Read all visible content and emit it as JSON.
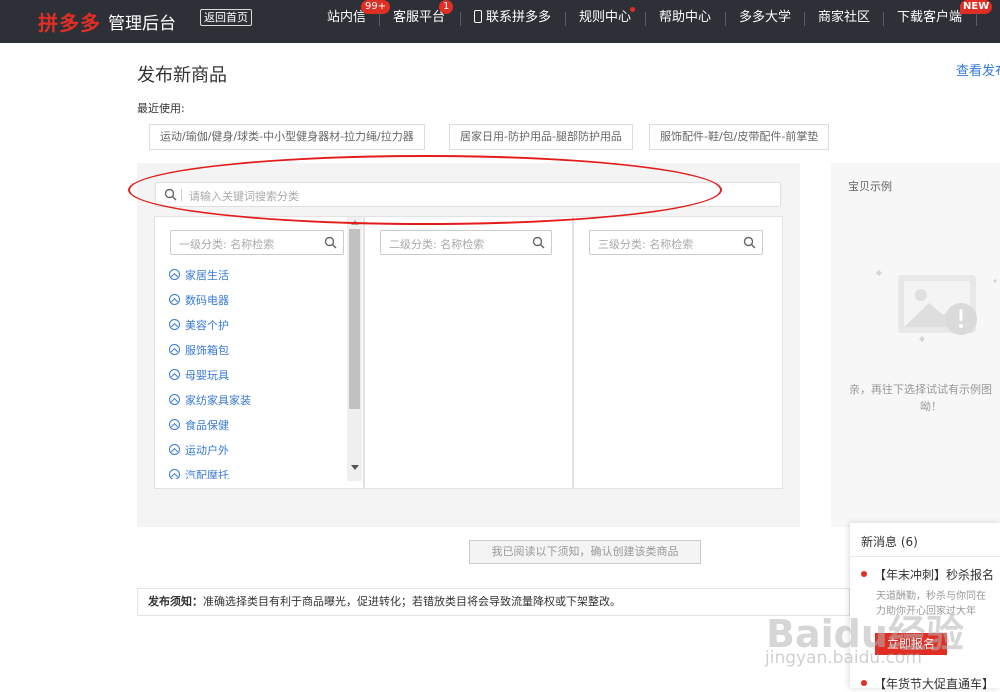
{
  "header": {
    "logo": "拼多多",
    "subtitle": "管理后台",
    "back_home": "返回首页",
    "nav": [
      {
        "label": "站内信",
        "badge": "99+"
      },
      {
        "label": "客服平台",
        "badge": "1"
      },
      {
        "label": "联系拼多多"
      },
      {
        "label": "规则中心"
      },
      {
        "label": "帮助中心"
      },
      {
        "label": "多多大学"
      },
      {
        "label": "商家社区"
      },
      {
        "label": "下载客户端",
        "badge": "NEW"
      }
    ]
  },
  "page": {
    "title": "发布新商品",
    "top_right_link": "查看发布",
    "recent_label": "最近使用:",
    "recent": [
      "运动/瑜伽/健身/球类-中小型健身器材-拉力绳/拉力器",
      "居家日用-防护用品-腿部防护用品",
      "服饰配件-鞋/包/皮带配件-前掌垫"
    ],
    "search_placeholder": "请输入关键词搜索分类",
    "level1_placeholder": "一级分类: 名称检索",
    "level2_placeholder": "二级分类: 名称检索",
    "level3_placeholder": "三级分类: 名称检索",
    "level1_items": [
      "家居生活",
      "数码电器",
      "美容个护",
      "服饰箱包",
      "母婴玩具",
      "家纺家具家装",
      "食品保健",
      "运动户外",
      "汽配摩托"
    ],
    "confirm_button": "我已阅读以下须知，确认创建该类商品",
    "notice_label": "发布须知：",
    "notice_text": "准确选择类目有利于商品曝光，促进转化；若错放类目将会导致流量降权或下架整改。"
  },
  "example": {
    "title": "宝贝示例",
    "empty_text_line1": "亲，再往下选择试试有示例图",
    "empty_text_line2": "呦！"
  },
  "messages": {
    "title": "新消息 (6)",
    "item1_title": "【年末冲刺】秒杀报名",
    "item1_body_line1": "天道酬勤，秒杀与你同在",
    "item1_body_line2": "力助你开心回家过大年",
    "item1_button": "立即报名",
    "item2_title": "【年货节大促直通车】"
  },
  "watermark": {
    "main": "Baidu经验",
    "sub": "jingyan.baidu.com"
  },
  "colors": {
    "brand_red": "#e02e24",
    "topbar": "#2d3036",
    "link_blue": "#3879d9",
    "annotation_red": "#e31b1b"
  }
}
